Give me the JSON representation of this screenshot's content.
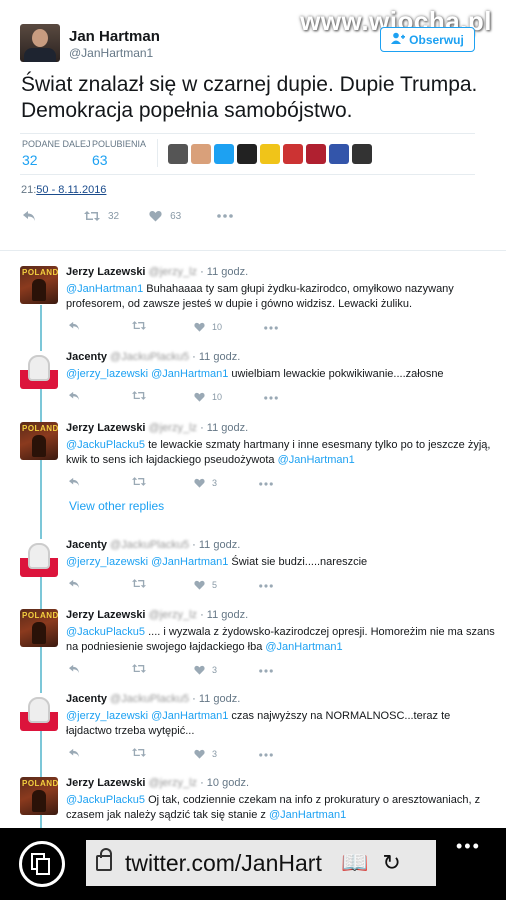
{
  "watermark": "www.wiocha.pl",
  "tweet": {
    "name": "Jan Hartman",
    "handle": "@JanHartman1",
    "follow_label": "Obserwuj",
    "text": "Świat znalazł się w czarnej dupie. Dupie Trumpa. Demokracja popełnia samobójstwo.",
    "retweets_label": "PODANE DALEJ",
    "retweets": "32",
    "likes_label": "POLUBIENIA",
    "likes": "63",
    "time_prefix": "21:",
    "time_link": "50 - 8.11.2016",
    "retweet_count": "32",
    "like_count": "63",
    "liker_colors": [
      "#555555",
      "#d9a07a",
      "#1da1f2",
      "#222222",
      "#f0c419",
      "#cc3333",
      "#b02030",
      "#3355aa",
      "#333333"
    ]
  },
  "replies": [
    {
      "name": "Jerzy Lazewski",
      "handle": "@jerzy_lz",
      "time": "11 godz.",
      "mentions": "@JanHartman1",
      "text": " Buhahaaaa ty sam głupi żydku-kazirodco, omyłkowo nazywany profesorem, od zawsze jesteś w dupie i gówno widzisz. Lewacki żuliku.",
      "likes": "10",
      "avatar": "poland"
    },
    {
      "name": "Jacenty",
      "handle": "@JackuPlacku5",
      "time": "11 godz.",
      "mentions": "@jerzy_lazewski @JanHartman1",
      "text": " uwielbiam lewackie pokwikiwanie....załosne",
      "likes": "10",
      "avatar": "eagle"
    },
    {
      "name": "Jerzy Lazewski",
      "handle": "@jerzy_lz",
      "time": "11 godz.",
      "mentions": "@JackuPlacku5",
      "text": " te lewackie szmaty hartmany i inne esesmany tylko po to jeszcze żyją, kwik to sens ich łajdackiego pseudożywota ",
      "tail": "@JanHartman1",
      "likes": "3",
      "avatar": "poland"
    },
    {
      "name": "Jacenty",
      "handle": "@JackuPlacku5",
      "time": "11 godz.",
      "mentions": "@jerzy_lazewski @JanHartman1",
      "text": " Świat sie budzi.....nareszcie",
      "likes": "5",
      "avatar": "eagle"
    },
    {
      "name": "Jerzy Lazewski",
      "handle": "@jerzy_lz",
      "time": "11 godz.",
      "mentions": "@JackuPlacku5",
      "text": " .... i wyzwala z żydowsko-kazirodczej opresji. Homoreżim nie ma szans na podniesienie swojego łajdackiego łba ",
      "tail": "@JanHartman1",
      "likes": "3",
      "avatar": "poland"
    },
    {
      "name": "Jacenty",
      "handle": "@JackuPlacku5",
      "time": "11 godz.",
      "mentions": "@jerzy_lazewski @JanHartman1",
      "text": " czas najwyższy na NORMALNOSC...teraz te łajdactwo trzeba wytępić...",
      "likes": "3",
      "avatar": "eagle"
    },
    {
      "name": "Jerzy Lazewski",
      "handle": "@jerzy_lz",
      "time": "10 godz.",
      "mentions": "@JackuPlacku5",
      "text": " Oj tak, codziennie czekam na info z prokuratury o aresztowaniach, z czasem jak należy sądzić tak się stanie z ",
      "tail": "@JanHartman1",
      "avatar": "poland"
    }
  ],
  "view_other": "View other replies",
  "browser": {
    "url": "twitter.com/JanHart"
  }
}
